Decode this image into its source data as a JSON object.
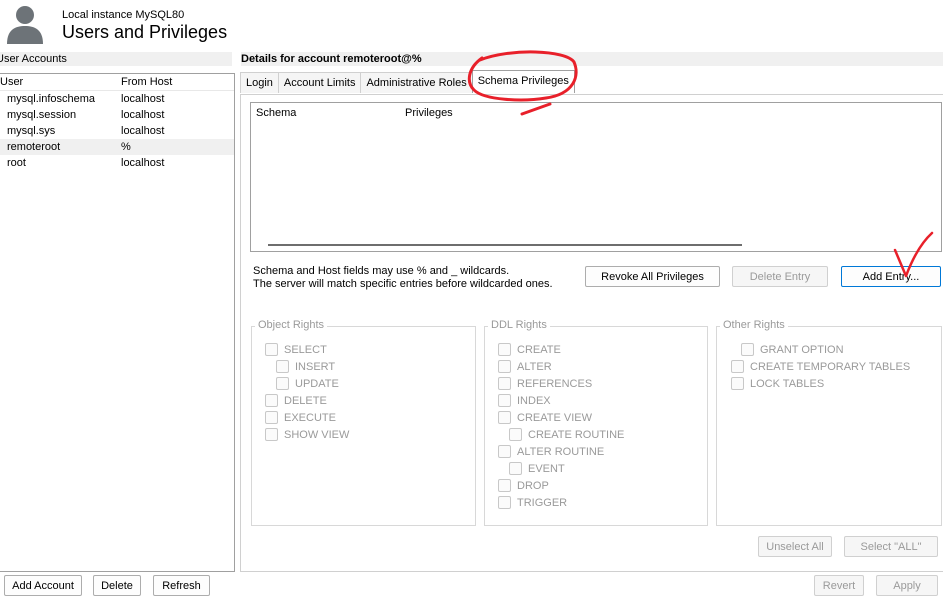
{
  "header": {
    "instance": "Local instance MySQL80",
    "title": "Users and Privileges"
  },
  "left": {
    "section_label": "User Accounts",
    "columns": [
      "User",
      "From Host"
    ],
    "rows": [
      {
        "user": "mysql.infoschema",
        "host": "localhost"
      },
      {
        "user": "mysql.session",
        "host": "localhost"
      },
      {
        "user": "mysql.sys",
        "host": "localhost"
      },
      {
        "user": "remoteroot",
        "host": "%"
      },
      {
        "user": "root",
        "host": "localhost"
      }
    ],
    "buttons": {
      "add": "Add Account",
      "delete": "Delete",
      "refresh": "Refresh"
    }
  },
  "details": {
    "label": "Details for account remoteroot@%",
    "tabs": [
      "Login",
      "Account Limits",
      "Administrative Roles",
      "Schema Privileges"
    ],
    "active_tab": "Schema Privileges",
    "table_columns": [
      "Schema",
      "Privileges"
    ],
    "hint_line1": "Schema and Host fields may use % and _ wildcards.",
    "hint_line2": "The server will match specific entries before wildcarded ones.",
    "buttons": {
      "revoke": "Revoke All Privileges",
      "delete_entry": "Delete Entry",
      "add_entry": "Add Entry..."
    },
    "groups": {
      "object": {
        "title": "Object Rights",
        "items": [
          "SELECT",
          "INSERT",
          "UPDATE",
          "DELETE",
          "EXECUTE",
          "SHOW VIEW"
        ]
      },
      "ddl": {
        "title": "DDL Rights",
        "items": [
          "CREATE",
          "ALTER",
          "REFERENCES",
          "INDEX",
          "CREATE VIEW",
          "CREATE ROUTINE",
          "ALTER ROUTINE",
          "EVENT",
          "DROP",
          "TRIGGER"
        ]
      },
      "other": {
        "title": "Other Rights",
        "items": [
          "GRANT OPTION",
          "CREATE TEMPORARY TABLES",
          "LOCK TABLES"
        ]
      }
    },
    "select_buttons": {
      "unselect": "Unselect All",
      "select_all": "Select \"ALL\""
    },
    "footer": {
      "revert": "Revert",
      "apply": "Apply"
    }
  },
  "colors": {
    "annotation": "#e8202a",
    "focus": "#0078d7"
  }
}
